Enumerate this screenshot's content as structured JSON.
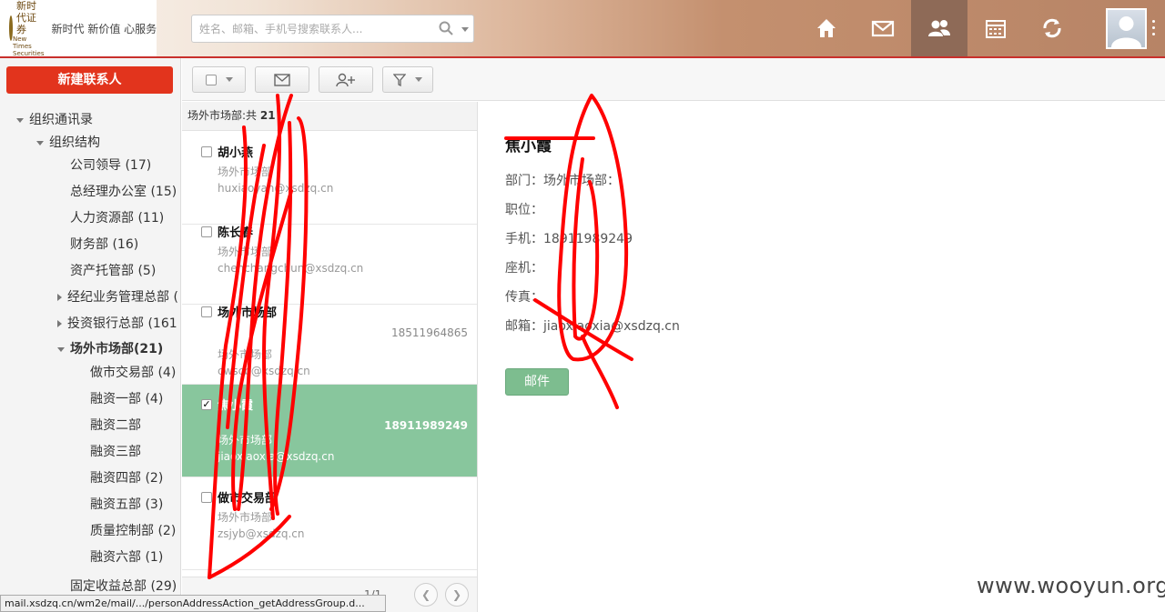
{
  "header": {
    "logo_cn": "新时代证券",
    "logo_en": "New Times Securities",
    "slogan": "新时代 新价值 心服务",
    "search_placeholder": "姓名、邮箱、手机号搜索联系人...",
    "nav_icons": [
      "home-icon",
      "mail-icon",
      "contacts-icon",
      "calendar-icon",
      "sync-icon"
    ],
    "active_nav": "contacts-icon"
  },
  "sidebar": {
    "new_contact": "新建联系人",
    "tree": [
      {
        "label": "组织通讯录",
        "count": ""
      },
      {
        "label": "组织结构",
        "count": ""
      },
      {
        "label": "公司领导",
        "count": "(17)"
      },
      {
        "label": "总经理办公室",
        "count": "(15)"
      },
      {
        "label": "人力资源部",
        "count": "(11)"
      },
      {
        "label": "财务部",
        "count": "(16)"
      },
      {
        "label": "资产托管部",
        "count": "(5)"
      },
      {
        "label": "经纪业务管理总部",
        "count": "("
      },
      {
        "label": "投资银行总部",
        "count": "(161"
      },
      {
        "label": "场外市场部",
        "count": "(21)"
      },
      {
        "label": "做市交易部",
        "count": "(4)"
      },
      {
        "label": "融资一部",
        "count": "(4)"
      },
      {
        "label": "融资二部",
        "count": ""
      },
      {
        "label": "融资三部",
        "count": ""
      },
      {
        "label": "融资四部",
        "count": "(2)"
      },
      {
        "label": "融资五部",
        "count": "(3)"
      },
      {
        "label": "质量控制部",
        "count": "(2)"
      },
      {
        "label": "融资六部",
        "count": "(1)"
      },
      {
        "label": "固定收益总部",
        "count": "(29)"
      }
    ]
  },
  "list": {
    "header_prefix": "场外市场部:共",
    "header_count": "21",
    "items": [
      {
        "name": "胡小燕",
        "phone": "",
        "dept": "场外市场部",
        "email": "huxiaoyan@xsdzq.cn",
        "checked": false
      },
      {
        "name": "陈长春",
        "phone": "",
        "dept": "场外市场部",
        "email": "chenchangchun@xsdzq.cn",
        "checked": false
      },
      {
        "name": "场外市场部",
        "phone": "18511964865",
        "dept": "场外市场部",
        "email": "cwscb@xsdzq.cn",
        "checked": false
      },
      {
        "name": "焦小霞",
        "phone": "18911989249",
        "dept": "场外市场部",
        "email": "jiaoxiaoxia@xsdzq.cn",
        "checked": true
      },
      {
        "name": "做市交易部",
        "phone": "",
        "dept": "场外市场部",
        "email": "zsjyb@xsdzq.cn",
        "checked": false
      }
    ],
    "page": "1/1"
  },
  "detail": {
    "name": "焦小霞",
    "department": "部门：场外市场部：",
    "position": "职位：",
    "mobile": "手机：18911989249",
    "landline": "座机：",
    "fax": "传真：",
    "email": "邮箱：jiaoxiaoxia@xsdzq.cn",
    "mail_button": "邮件"
  },
  "watermark": "www.wooyun.org",
  "status_url": "mail.xsdzq.cn/wm2e/mail/.../personAddressAction_getAddressGroup.d..."
}
